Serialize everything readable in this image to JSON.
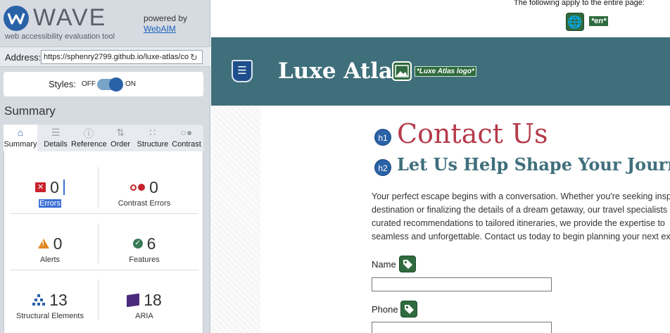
{
  "wave": {
    "logo_text": "WAVE",
    "tagline": "web accessibility evaluation tool",
    "powered_by": "powered by",
    "webaim": "WebAIM"
  },
  "address": {
    "label": "Address:",
    "value": "https://sphenry2799.github.io/luxe-atlas/co"
  },
  "styles": {
    "label": "Styles:",
    "off": "OFF",
    "on": "ON",
    "state": "on"
  },
  "summary_heading": "Summary",
  "tabs": [
    {
      "label": "Summary",
      "icon": "home-icon",
      "active": true
    },
    {
      "label": "Details",
      "icon": "list-icon"
    },
    {
      "label": "Reference",
      "icon": "info-icon"
    },
    {
      "label": "Order",
      "icon": "order-icon"
    },
    {
      "label": "Structure",
      "icon": "structure-icon"
    },
    {
      "label": "Contrast",
      "icon": "contrast-icon"
    }
  ],
  "stats": {
    "errors": {
      "value": "0",
      "label": "Errors"
    },
    "contrast_errors": {
      "value": "0",
      "label": "Contrast Errors"
    },
    "alerts": {
      "value": "0",
      "label": "Alerts"
    },
    "features": {
      "value": "6",
      "label": "Features"
    },
    "structural": {
      "value": "13",
      "label": "Structural Elements"
    },
    "aria": {
      "value": "18",
      "label": "ARIA"
    }
  },
  "page": {
    "note": "The following apply to the entire page:",
    "lang_tag": "*en*",
    "site_title": "Luxe Atlas",
    "logo_alt": "*Luxe Atlas logo*",
    "h1_badge": "h1",
    "h1": "Contact Us",
    "h2_badge": "h2",
    "h2": "Let Us Help Shape Your Journey",
    "intro_lines": [
      "Your perfect escape begins with a conversation. Whether you're seeking insp",
      "destination or finalizing the details of a dream getaway, our travel specialists",
      "curated recommendations to tailored itineraries, we provide the expertise to",
      "seamless and unforgettable. Contact us today to begin planning your next ext"
    ],
    "name_label": "Name",
    "phone_label": "Phone"
  },
  "colors": {
    "header_bg": "#3f6f7b",
    "h1": "#b53a4a",
    "h2": "#3f6f7b",
    "wave_blue": "#2a62a8",
    "feature_green": "#2f6b3e",
    "error_red": "#c9222c"
  }
}
